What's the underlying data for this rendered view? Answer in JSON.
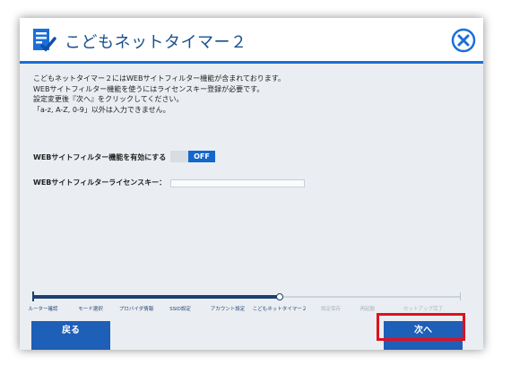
{
  "window": {
    "title": "こどもネットタイマー２",
    "app_icon": "checklist-icon",
    "close_icon": "close-circle-icon",
    "accent_color": "#1a6fd8"
  },
  "description": {
    "lines": [
      "こどもネットタイマー２にはWEBサイトフィルター機能が含まれております。",
      "WEBサイトフィルター機能を使うにはライセンスキー登録が必要です。",
      "設定変更後『次へ』をクリックしてください。",
      "「a-z, A-Z, 0-9」以外は入力できません。"
    ]
  },
  "form": {
    "filter_toggle_label": "WEBサイトフィルター機能を有効にする",
    "filter_toggle_state": "OFF",
    "license_key_label": "WEBサイトフィルターライセンスキー：",
    "license_key_value": ""
  },
  "progress": {
    "steps": [
      {
        "label": "ルーター確認",
        "status": "done"
      },
      {
        "label": "モード選択",
        "status": "done"
      },
      {
        "label": "プロバイダ情報",
        "status": "done"
      },
      {
        "label": "SSID設定",
        "status": "done"
      },
      {
        "label": "アカウント設定",
        "status": "done"
      },
      {
        "label": "こどもネットタイマー２",
        "status": "current"
      },
      {
        "label": "設定保存",
        "status": "pending"
      },
      {
        "label": "再起動",
        "status": "pending"
      },
      {
        "label": "セットアップ完了",
        "status": "pending"
      }
    ],
    "current_step_index": 5
  },
  "buttons": {
    "back_label": "戻る",
    "next_label": "次へ"
  },
  "annotation": {
    "highlight_color": "#e0101e",
    "highlighted": "next-button"
  }
}
